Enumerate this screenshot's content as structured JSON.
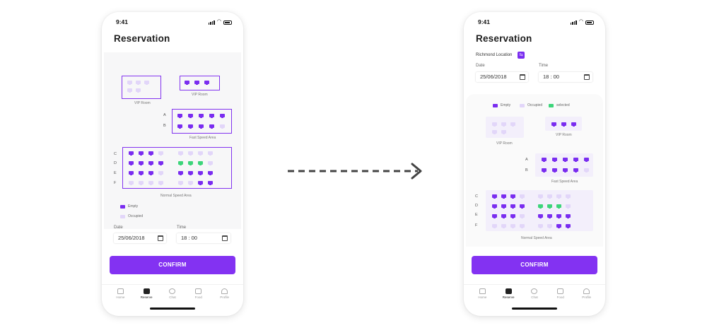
{
  "left": {
    "status_time": "9:41",
    "title": "Reservation",
    "vip_room_label": "VIP Room",
    "vip_room_label_2": "VIP Room",
    "fast_label": "Fast Speed Area",
    "normal_label": "Normal Speed Area",
    "row_a": "A",
    "row_b": "B",
    "row_c": "C",
    "row_d": "D",
    "row_e": "E",
    "row_f": "F",
    "legend_empty": "Empty",
    "legend_occupied": "Occupied",
    "date_label": "Date",
    "date_value": "25/06/2018",
    "time_label": "Time",
    "time_value": "18 : 00",
    "confirm": "CONFIRM"
  },
  "right": {
    "status_time": "9:41",
    "title": "Reservation",
    "location": "Richmond Location",
    "date_label": "Date",
    "date_value": "25/06/2018",
    "time_label": "Time",
    "time_value": "18 : 00",
    "legend_empty": "Empty",
    "legend_occupied": "Occupied",
    "legend_selected": "selected",
    "vip_room_label": "VIP Room",
    "vip_room_label_2": "VIP Room",
    "fast_label": "Fast Speed Area",
    "normal_label": "Normal Speed Area",
    "row_a": "A",
    "row_b": "B",
    "row_c": "C",
    "row_d": "D",
    "row_e": "E",
    "row_f": "F",
    "confirm": "CONFIRM"
  },
  "nav": [
    "Home",
    "Reserve",
    "Chat",
    "Food",
    "Profile"
  ],
  "colors": {
    "accent": "#8332f2",
    "empty_seat": "#7a2df0",
    "occupied_seat": "#e2d6f9",
    "selected_seat": "#3dd57a"
  },
  "icons": [
    "signal-icon",
    "wifi-icon",
    "battery-icon",
    "calendar-icon",
    "location-swap-icon",
    "home-icon",
    "reserve-icon",
    "chat-icon",
    "food-icon",
    "profile-icon",
    "arrow-right-icon"
  ],
  "seat_maps": {
    "vip1": [
      "ooo",
      "oo"
    ],
    "vip2": [
      "eee"
    ],
    "fast": [
      "eeeee",
      "eeeeo"
    ],
    "normal": [
      "eeeo.oooo",
      "eeee.ssso",
      "eeeo.eeee",
      "oooo.ooee"
    ]
  }
}
